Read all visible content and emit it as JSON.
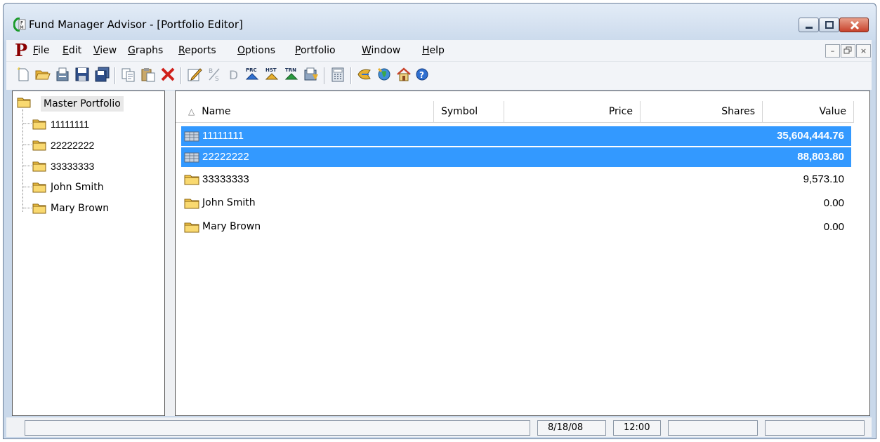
{
  "window": {
    "title": "Fund Manager Advisor - [Portfolio Editor]",
    "logo": "fm-logo-icon",
    "accent": "#3399ff"
  },
  "menu": {
    "app_letter": "P",
    "items": [
      {
        "label": "File",
        "mnemonic": "F",
        "rest": "ile"
      },
      {
        "label": "Edit",
        "mnemonic": "E",
        "rest": "dit"
      },
      {
        "label": "View",
        "mnemonic": "V",
        "rest": "iew"
      },
      {
        "label": "Graphs",
        "mnemonic": "G",
        "rest": "raphs"
      },
      {
        "label": "Reports",
        "mnemonic": "R",
        "rest": "eports"
      },
      {
        "label": "Options",
        "mnemonic": "O",
        "rest": "ptions"
      },
      {
        "label": "Portfolio",
        "mnemonic": "P",
        "rest": "ortfolio"
      },
      {
        "label": "Window",
        "mnemonic": "W",
        "rest": "indow"
      },
      {
        "label": "Help",
        "mnemonic": "H",
        "rest": "elp"
      }
    ],
    "mdi_buttons": [
      "–",
      "🗗",
      "×"
    ]
  },
  "toolbar": {
    "buttons": [
      "new-icon",
      "open-icon",
      "properties-icon",
      "save-icon",
      "save-all-icon",
      "copy-icon",
      "paste-icon",
      "delete-icon",
      "edit-icon",
      "split-icon",
      "dividend-icon",
      "prc-download-icon",
      "hst-download-icon",
      "trn-download-icon",
      "update-icon",
      "calculator-icon",
      "wizard-icon",
      "globe-icon",
      "home-icon",
      "help-icon"
    ],
    "labels": {
      "split": "⅟",
      "dividend": "D",
      "prc": "PRC",
      "hst": "HST",
      "trn": "TRN"
    }
  },
  "tree": {
    "root": "Master Portfolio",
    "children": [
      "11111111",
      "22222222",
      "33333333",
      "John Smith",
      "Mary Brown"
    ]
  },
  "list": {
    "sort_glyph": "△",
    "columns": {
      "name": "Name",
      "symbol": "Symbol",
      "price": "Price",
      "shares": "Shares",
      "value": "Value"
    },
    "rows": [
      {
        "name": "11111111",
        "value": "35,604,444.76",
        "selected": true,
        "icon": "portfolio-grid-icon"
      },
      {
        "name": "22222222",
        "value": "88,803.80",
        "selected": true,
        "icon": "portfolio-grid-icon"
      },
      {
        "name": "33333333",
        "value": "9,573.10",
        "selected": false,
        "icon": "folder-icon"
      },
      {
        "name": "John Smith",
        "value": "0.00",
        "selected": false,
        "icon": "folder-icon"
      },
      {
        "name": "Mary Brown",
        "value": "0.00",
        "selected": false,
        "icon": "folder-icon"
      }
    ]
  },
  "status": {
    "date": "8/18/08",
    "time": "12:00"
  }
}
